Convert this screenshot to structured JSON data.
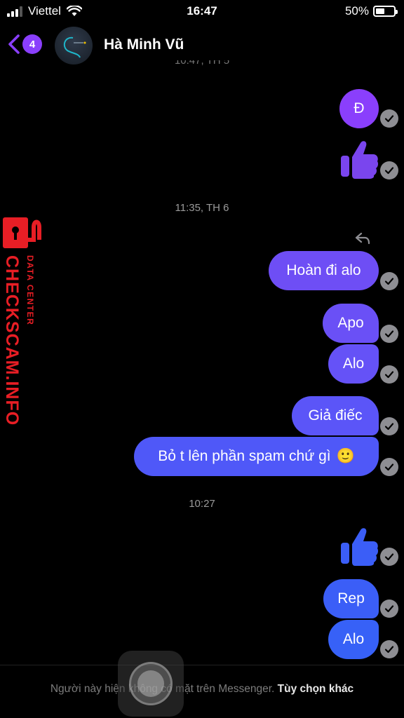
{
  "status_bar": {
    "carrier": "Viettel",
    "time": "16:47",
    "battery": "50%",
    "battery_level": 0.5
  },
  "header": {
    "unread_count": "4",
    "contact_name": "Hà Minh Vũ",
    "avatar_text": ""
  },
  "chat": {
    "partial_timestamp": "10:47, TH 5",
    "timestamps": [
      "11:35, TH 6",
      "10:27"
    ],
    "messages": [
      {
        "text": "Đ",
        "type": "text"
      },
      {
        "type": "like",
        "icon": "thumbs-up-icon"
      },
      {
        "text": "Hoàn đi alo",
        "type": "text"
      },
      {
        "text": "Apo",
        "type": "text"
      },
      {
        "text": "Alo",
        "type": "text"
      },
      {
        "text": "Giả điếc",
        "type": "text"
      },
      {
        "text": "Bỏ t lên phần spam chứ gì",
        "emoji": "🙂",
        "type": "text"
      },
      {
        "type": "like",
        "icon": "thumbs-up-icon"
      },
      {
        "text": "Rep",
        "type": "text"
      },
      {
        "text": "Alo",
        "type": "text"
      }
    ]
  },
  "footer": {
    "notice": "Người này hiện không có mặt trên Messenger.",
    "link": "Tùy chọn khác"
  },
  "watermark": {
    "title": "CHECKSCAM.INFO",
    "subtitle": "DATA CENTER"
  },
  "colors": {
    "bubble_purple": "#8a3ffc",
    "bubble_violet": "#6e4ef5",
    "bubble_indigo": "#5b55f8",
    "bubble_blue": "#3b5ef7",
    "check_gray": "#8e8e93",
    "brand_red": "#e81e25"
  }
}
